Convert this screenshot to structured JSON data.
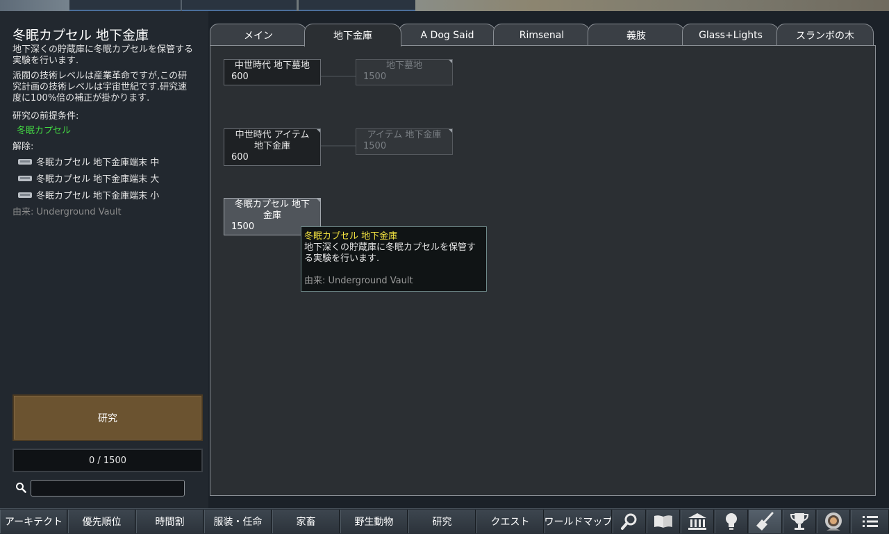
{
  "detail": {
    "title": "冬眠カプセル 地下金庫",
    "description": "地下深くの貯蔵庫に冬眠カプセルを保管する実験を行います.",
    "tech_note": "派閥の技術レベルは産業革命ですが,この研究計画の技術レベルは宇宙世紀です.研究速度に100%倍の補正が掛かります.",
    "prereq_label": "研究の前提条件:",
    "prereq_item": "冬眠カプセル",
    "unlock_label": "解除:",
    "unlocks": [
      "冬眠カプセル 地下金庫端末 中",
      "冬眠カプセル 地下金庫端末 大",
      "冬眠カプセル 地下金庫端末 小"
    ],
    "source": "由来:  Underground Vault",
    "research_button": "研究",
    "progress_text": "0 / 1500",
    "progress_fraction": 0,
    "search_placeholder": ""
  },
  "tabs": [
    {
      "label": "メイン",
      "active": false
    },
    {
      "label": "地下金庫",
      "active": true
    },
    {
      "label": "A Dog Said",
      "active": false
    },
    {
      "label": "Rimsenal",
      "active": false
    },
    {
      "label": "義肢",
      "active": false
    },
    {
      "label": "Glass+Lights",
      "active": false
    },
    {
      "label": "スランボの木",
      "active": false
    }
  ],
  "nodes": [
    {
      "name": "中世時代 地下墓地",
      "cost": "600",
      "state": "available"
    },
    {
      "name": "地下墓地",
      "cost": "1500",
      "state": "locked"
    },
    {
      "name": "中世時代 アイテム 地下金庫",
      "cost": "600",
      "state": "available"
    },
    {
      "name": "アイテム 地下金庫",
      "cost": "1500",
      "state": "locked"
    },
    {
      "name": "冬眠カプセル 地下金庫",
      "cost": "1500",
      "state": "selected"
    }
  ],
  "tooltip": {
    "title": "冬眠カプセル 地下金庫",
    "description": "地下深くの貯蔵庫に冬眠カプセルを保管する実験を行います.",
    "source": "由来: Underground Vault"
  },
  "bottom_bar": {
    "buttons": [
      "アーキテクト",
      "優先順位",
      "時間割",
      "服装・任命",
      "家畜",
      "野生動物",
      "研究",
      "クエスト",
      "ワールドマップ"
    ],
    "icons": [
      "search-icon",
      "book-icon",
      "factions-icon",
      "lightbulb-icon",
      "broom-icon",
      "trophy-icon",
      "astronaut-icon",
      "menu-list-icon"
    ],
    "active_icon": "broom-icon"
  },
  "colors": {
    "prereq_green": "#44dd44",
    "tooltip_title": "#f0e040",
    "research_button": "#6b5330"
  }
}
